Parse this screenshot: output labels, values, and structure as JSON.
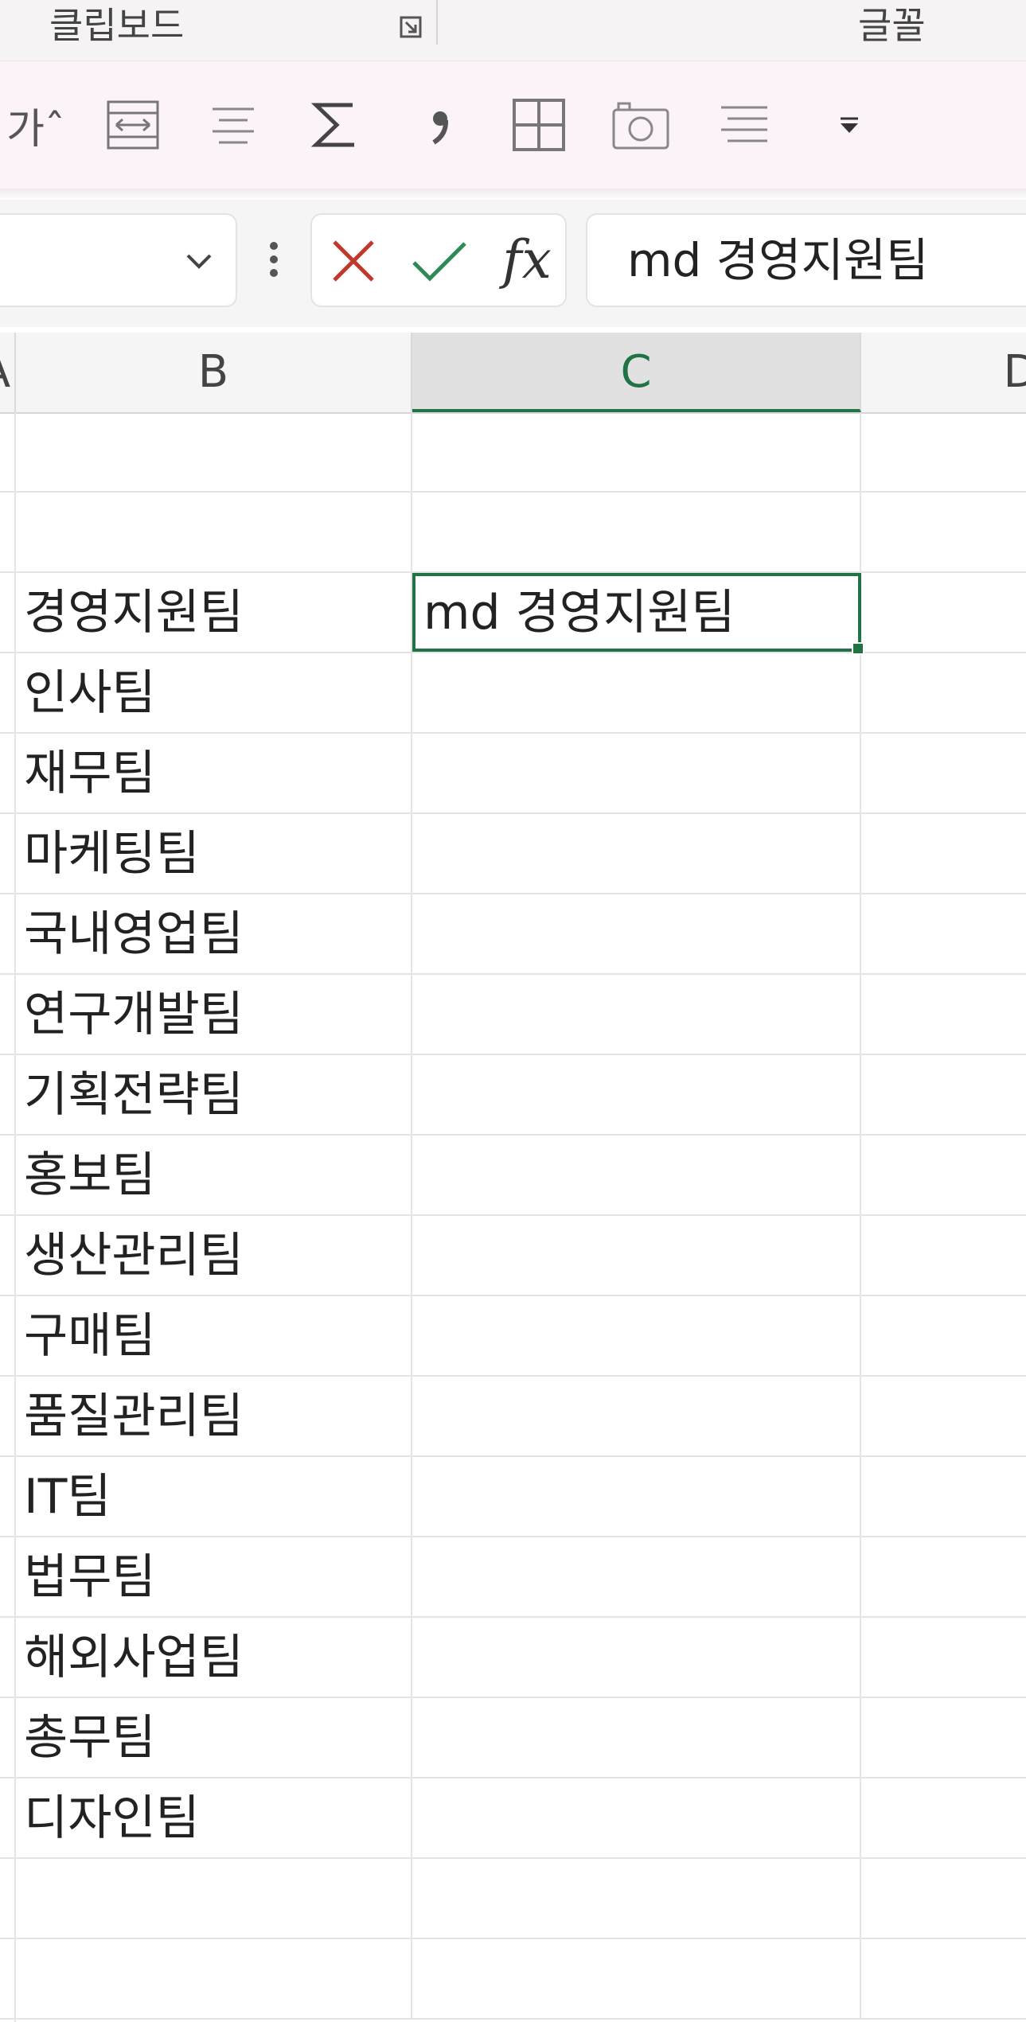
{
  "ribbon": {
    "groups": [
      {
        "label": "클립보드"
      },
      {
        "label": "글꼴"
      }
    ],
    "qat": {
      "font_size_up_label": "가ˆ"
    }
  },
  "formula_bar": {
    "name_box_value": "",
    "formula_value": "md 경영지원팀",
    "fx_label": "fx"
  },
  "sheet": {
    "columns": [
      "A",
      "B",
      "C",
      "D"
    ],
    "selected_column": "C",
    "rows": [
      {
        "b": "",
        "c": ""
      },
      {
        "b": "",
        "c": ""
      },
      {
        "b": "경영지원팀",
        "c": "md 경영지원팀"
      },
      {
        "b": "인사팀",
        "c": ""
      },
      {
        "b": "재무팀",
        "c": ""
      },
      {
        "b": "마케팅팀",
        "c": ""
      },
      {
        "b": "국내영업팀",
        "c": ""
      },
      {
        "b": "연구개발팀",
        "c": ""
      },
      {
        "b": "기획전략팀",
        "c": ""
      },
      {
        "b": "홍보팀",
        "c": ""
      },
      {
        "b": "생산관리팀",
        "c": ""
      },
      {
        "b": "구매팀",
        "c": ""
      },
      {
        "b": "품질관리팀",
        "c": ""
      },
      {
        "b": "IT팀",
        "c": ""
      },
      {
        "b": "법무팀",
        "c": ""
      },
      {
        "b": "해외사업팀",
        "c": ""
      },
      {
        "b": "총무팀",
        "c": ""
      },
      {
        "b": "디자인팀",
        "c": ""
      },
      {
        "b": "",
        "c": ""
      },
      {
        "b": "",
        "c": ""
      }
    ],
    "active_cell_row_index": 2
  },
  "colors": {
    "accent": "#217346",
    "cancel": "#c0392b",
    "enter": "#2e8b57"
  }
}
